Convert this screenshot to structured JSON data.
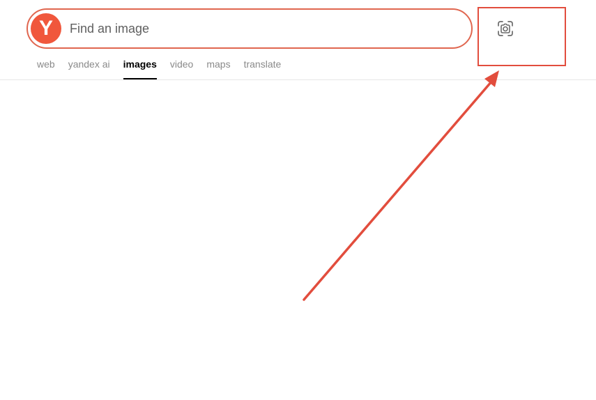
{
  "search": {
    "logo_letter": "Y",
    "placeholder": "Find an image",
    "value": ""
  },
  "nav": {
    "tabs": [
      {
        "label": "web",
        "active": false
      },
      {
        "label": "yandex ai",
        "active": false
      },
      {
        "label": "images",
        "active": true
      },
      {
        "label": "video",
        "active": false
      },
      {
        "label": "maps",
        "active": false
      },
      {
        "label": "translate",
        "active": false
      }
    ]
  },
  "annotation": {
    "highlight_color": "#e24d3d",
    "arrow_color": "#e24d3d",
    "target": "camera-icon"
  },
  "colors": {
    "brand": "#f0573c",
    "search_border": "#e0664f"
  }
}
